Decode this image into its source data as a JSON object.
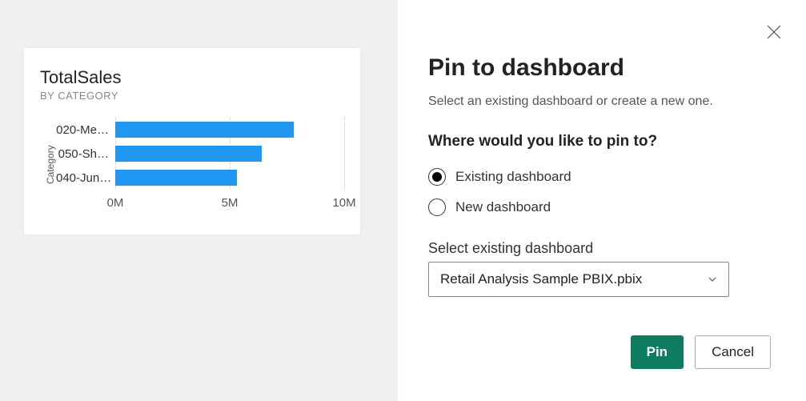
{
  "dialog": {
    "title": "Pin to dashboard",
    "subtitle": "Select an existing dashboard or create a new one.",
    "question": "Where would you like to pin to?",
    "option_existing": "Existing dashboard",
    "option_new": "New dashboard",
    "select_label": "Select existing dashboard",
    "select_value": "Retail Analysis Sample PBIX.pbix",
    "pin_label": "Pin",
    "cancel_label": "Cancel"
  },
  "chart": {
    "title": "TotalSales",
    "subtitle": "BY CATEGORY",
    "y_axis_label": "Category"
  },
  "chart_data": {
    "type": "bar",
    "orientation": "horizontal",
    "title": "TotalSales",
    "subtitle": "BY CATEGORY",
    "xlabel": "",
    "ylabel": "Category",
    "xlim": [
      0,
      10000000
    ],
    "x_ticks": [
      0,
      5000000,
      10000000
    ],
    "x_tick_labels": [
      "0M",
      "5M",
      "10M"
    ],
    "categories": [
      "020-Me…",
      "050-Sh…",
      "040-Jun…"
    ],
    "values": [
      7800000,
      6400000,
      5300000
    ]
  }
}
